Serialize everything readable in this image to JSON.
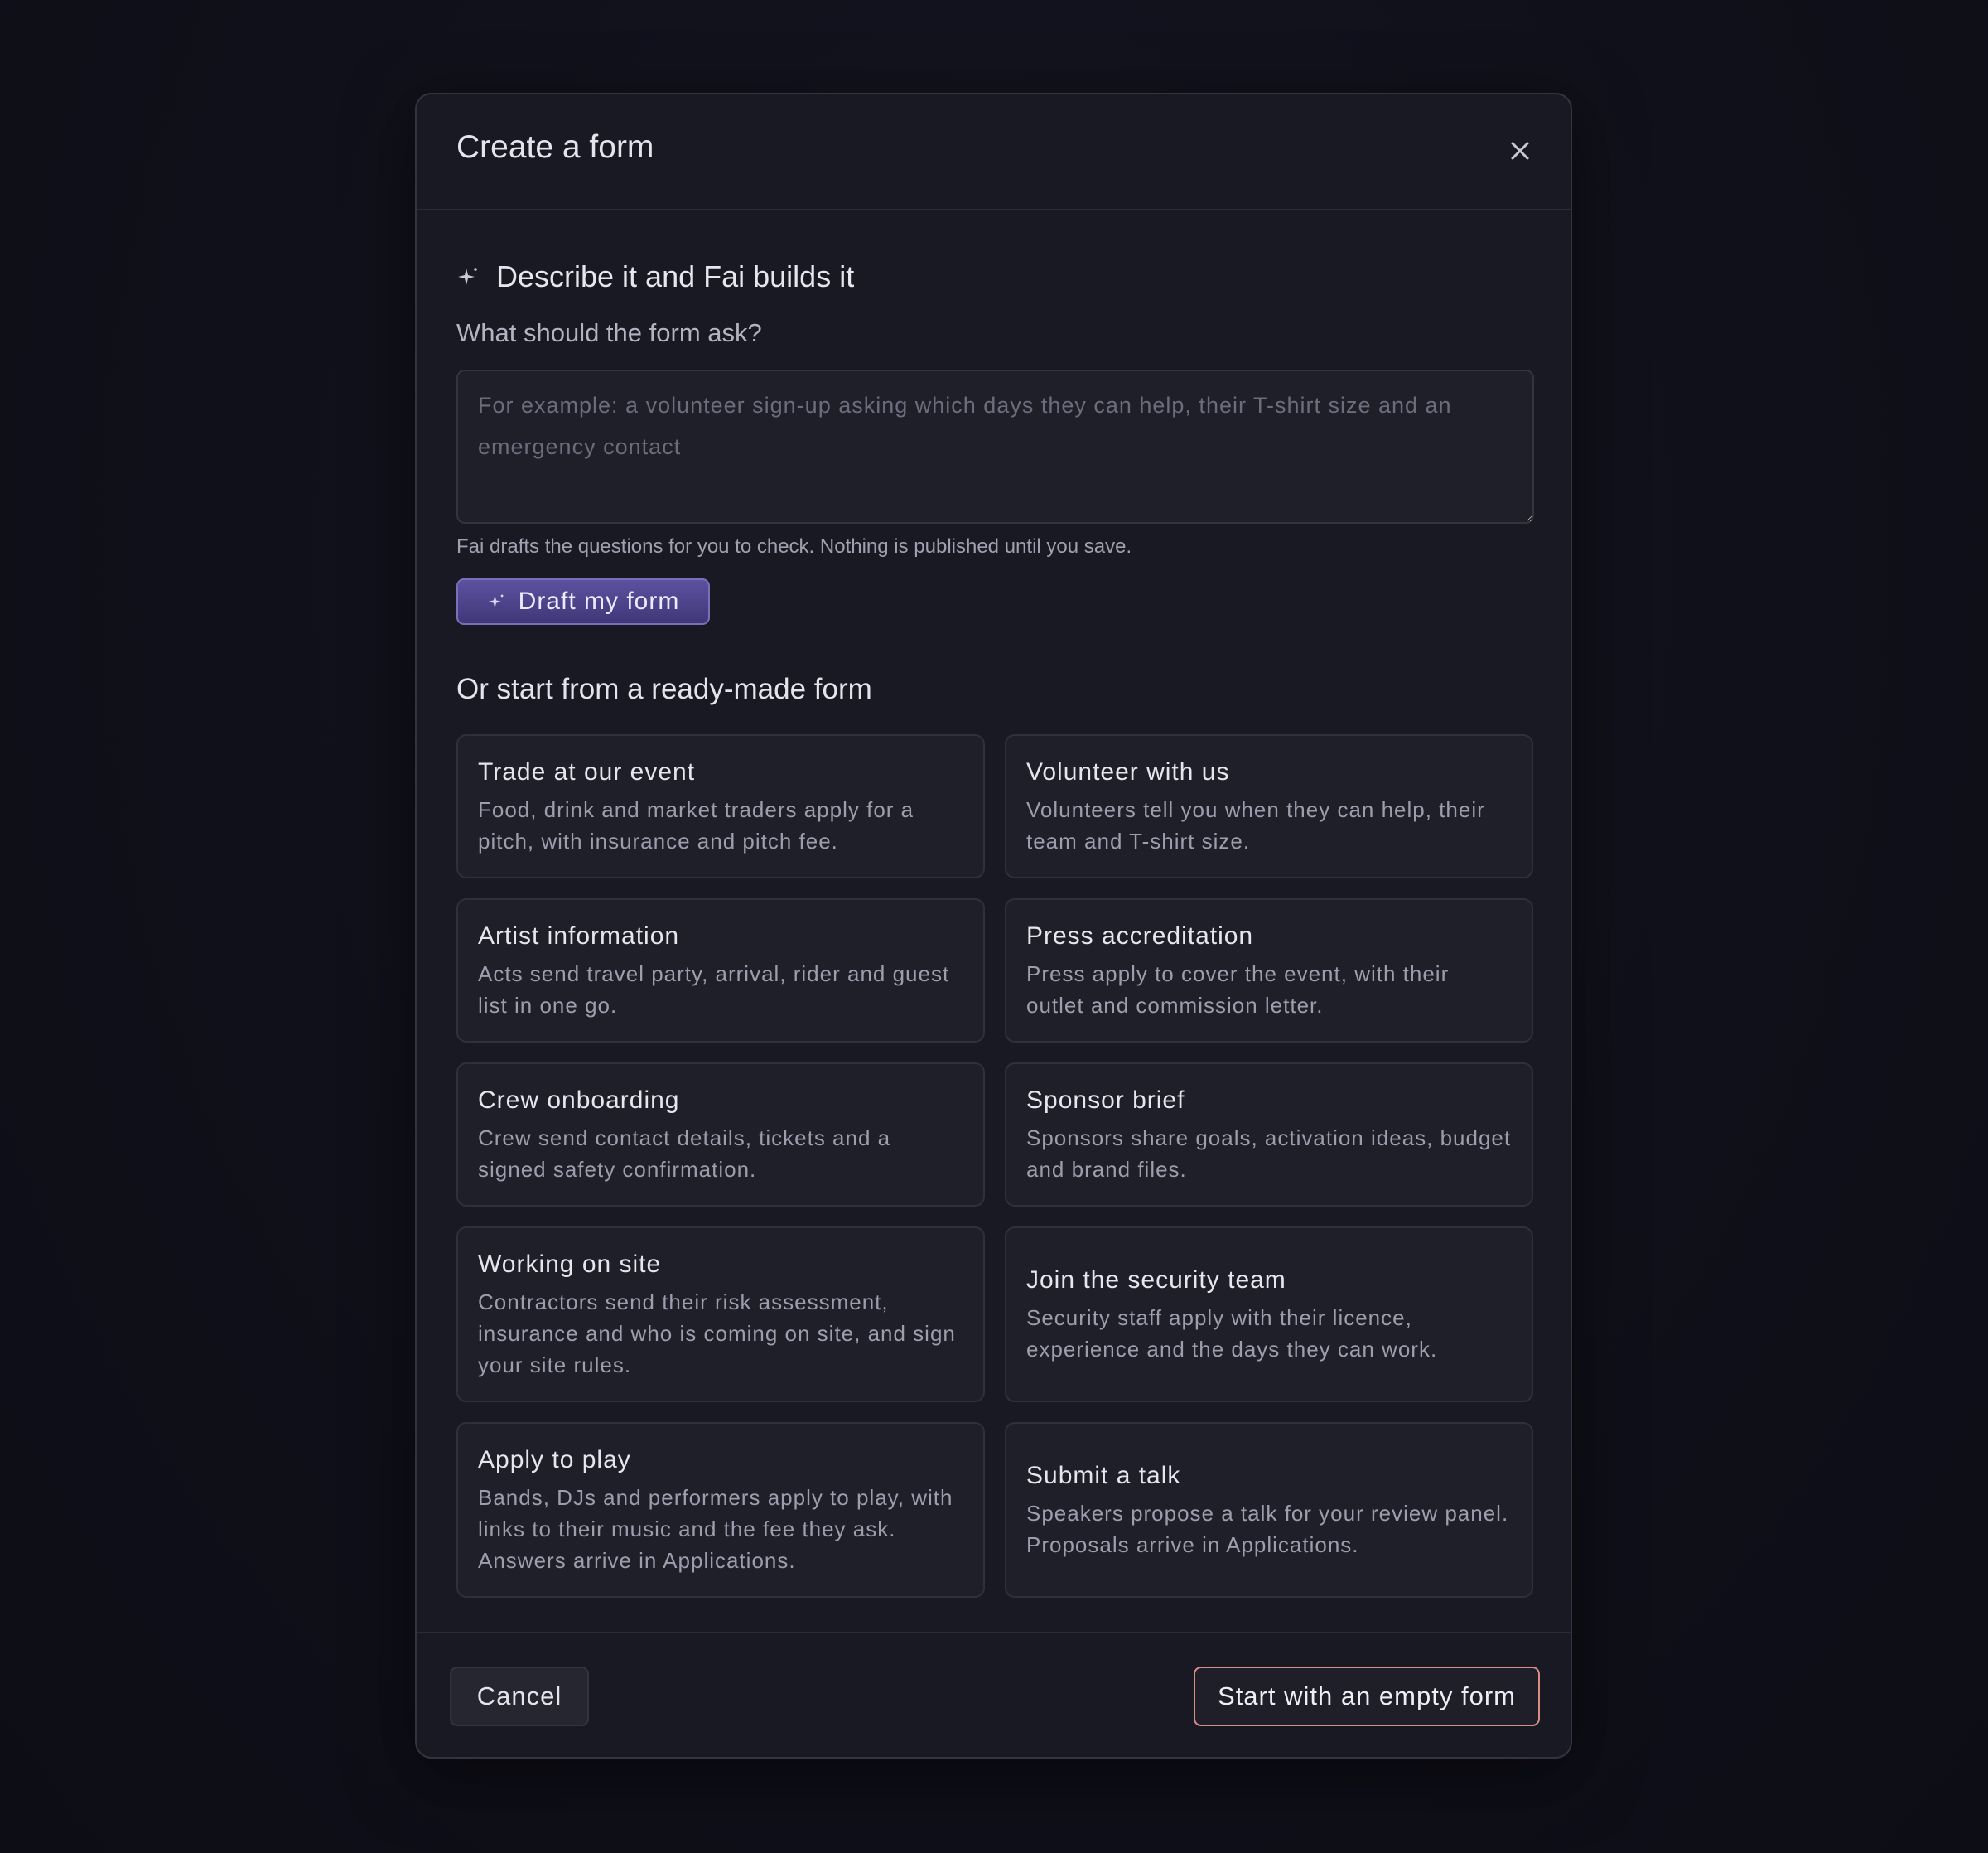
{
  "dialog": {
    "title": "Create a form",
    "close_icon": "close-icon"
  },
  "ai_builder": {
    "heading": "Describe it and Fai builds it",
    "heading_icon": "sparkle-icon",
    "field_label": "What should the form ask?",
    "prompt_value": "",
    "prompt_placeholder": "For example: a volunteer sign-up asking which days they can help, their T-shirt size and an emergency contact",
    "helper_text": "Fai drafts the questions for you to check. Nothing is published until you save.",
    "draft_button_label": "Draft my form",
    "draft_button_icon": "sparkle-icon"
  },
  "templates": {
    "heading": "Or start from a ready-made form",
    "items": [
      {
        "title": "Trade at our event",
        "description": "Food, drink and market traders apply for a pitch, with insurance and pitch fee."
      },
      {
        "title": "Volunteer with us",
        "description": "Volunteers tell you when they can help, their team and T-shirt size."
      },
      {
        "title": "Artist information",
        "description": "Acts send travel party, arrival, rider and guest list in one go."
      },
      {
        "title": "Press accreditation",
        "description": "Press apply to cover the event, with their outlet and commission letter."
      },
      {
        "title": "Crew onboarding",
        "description": "Crew send contact details, tickets and a signed safety confirmation."
      },
      {
        "title": "Sponsor brief",
        "description": "Sponsors share goals, activation ideas, budget and brand files."
      },
      {
        "title": "Working on site",
        "description": "Contractors send their risk assessment, insurance and who is coming on site, and sign your site rules."
      },
      {
        "title": "Join the security team",
        "description": "Security staff apply with their licence, experience and the days they can work."
      },
      {
        "title": "Apply to play",
        "description": "Bands, DJs and performers apply to play, with links to their music and the fee they ask. Answers arrive in Applications."
      },
      {
        "title": "Submit a talk",
        "description": "Speakers propose a talk for your review panel. Proposals arrive in Applications."
      }
    ]
  },
  "footer": {
    "cancel_label": "Cancel",
    "empty_form_label": "Start with an empty form"
  },
  "colors": {
    "accent_button": "#4f4590",
    "primary_outline": "#d98c86",
    "modal_background": "#191923"
  }
}
